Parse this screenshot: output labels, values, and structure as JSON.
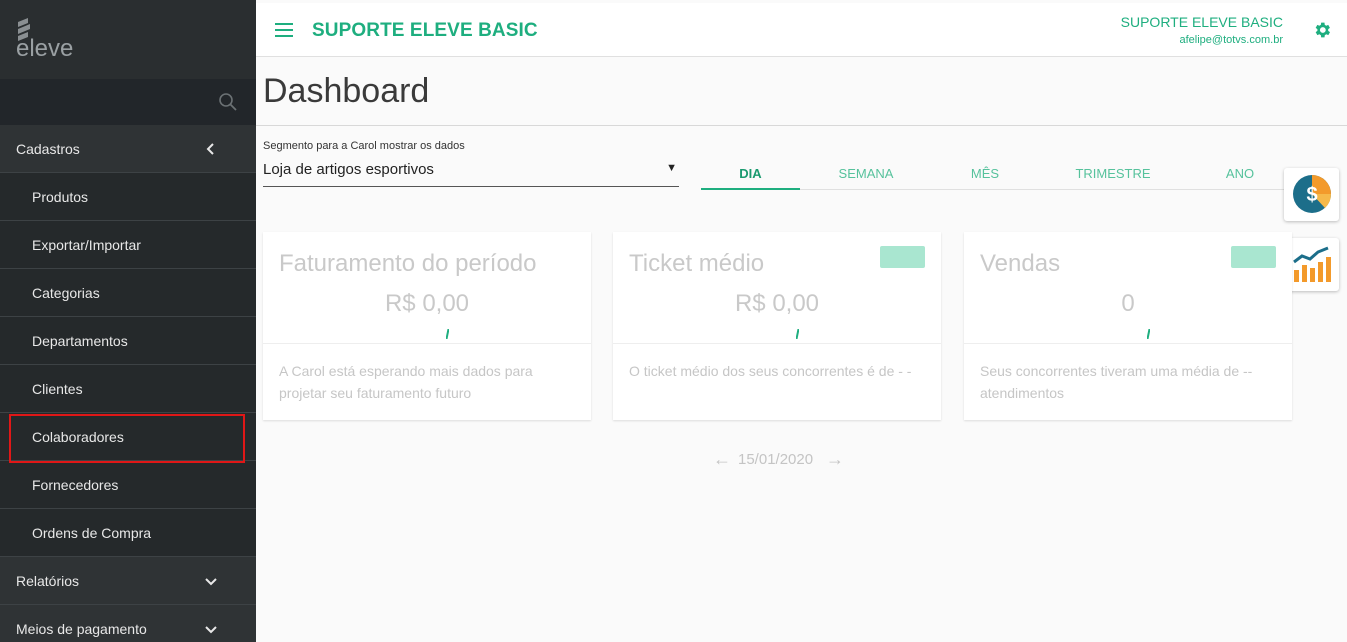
{
  "brand": {
    "logo_text": "eleve"
  },
  "header": {
    "app_title": "SUPORTE ELEVE BASIC",
    "user_name": "SUPORTE ELEVE BASIC",
    "user_email": "afelipe@totvs.com.br"
  },
  "sidebar": {
    "groups": [
      {
        "label": "Cadastros",
        "state": "expanded"
      },
      {
        "label": "Relatórios",
        "state": "collapsed"
      },
      {
        "label": "Meios de pagamento",
        "state": "collapsed"
      }
    ],
    "items": [
      {
        "label": "Produtos"
      },
      {
        "label": "Exportar/Importar"
      },
      {
        "label": "Categorias"
      },
      {
        "label": "Departamentos"
      },
      {
        "label": "Clientes"
      },
      {
        "label": "Colaboradores",
        "highlighted": true
      },
      {
        "label": "Fornecedores"
      },
      {
        "label": "Ordens de Compra"
      }
    ]
  },
  "page": {
    "title": "Dashboard"
  },
  "segment": {
    "label": "Segmento para a Carol mostrar os dados",
    "value": "Loja de artigos esportivos"
  },
  "tabs": [
    {
      "label": "DIA",
      "active": true
    },
    {
      "label": "SEMANA",
      "active": false
    },
    {
      "label": "MÊS",
      "active": false
    },
    {
      "label": "TRIMESTRE",
      "active": false
    },
    {
      "label": "ANO",
      "active": false
    }
  ],
  "cards": [
    {
      "title": "Faturamento do período",
      "value": "R$ 0,00",
      "description": "A Carol está esperando mais dados para projetar seu faturamento futuro"
    },
    {
      "title": "Ticket médio",
      "value": "R$ 0,00",
      "description": "O ticket médio dos seus concorrentes é de - -"
    },
    {
      "title": "Vendas",
      "value": "0",
      "description": "Seus concorrentes tiveram uma média de -- atendimentos"
    }
  ],
  "date_nav": {
    "date": "15/01/2020",
    "prev_icon": "arrow-left-icon",
    "next_icon": "arrow-right-icon"
  },
  "colors": {
    "accent": "#1eae7f",
    "sidebar": "#2f3335",
    "highlight": "#e01717"
  }
}
